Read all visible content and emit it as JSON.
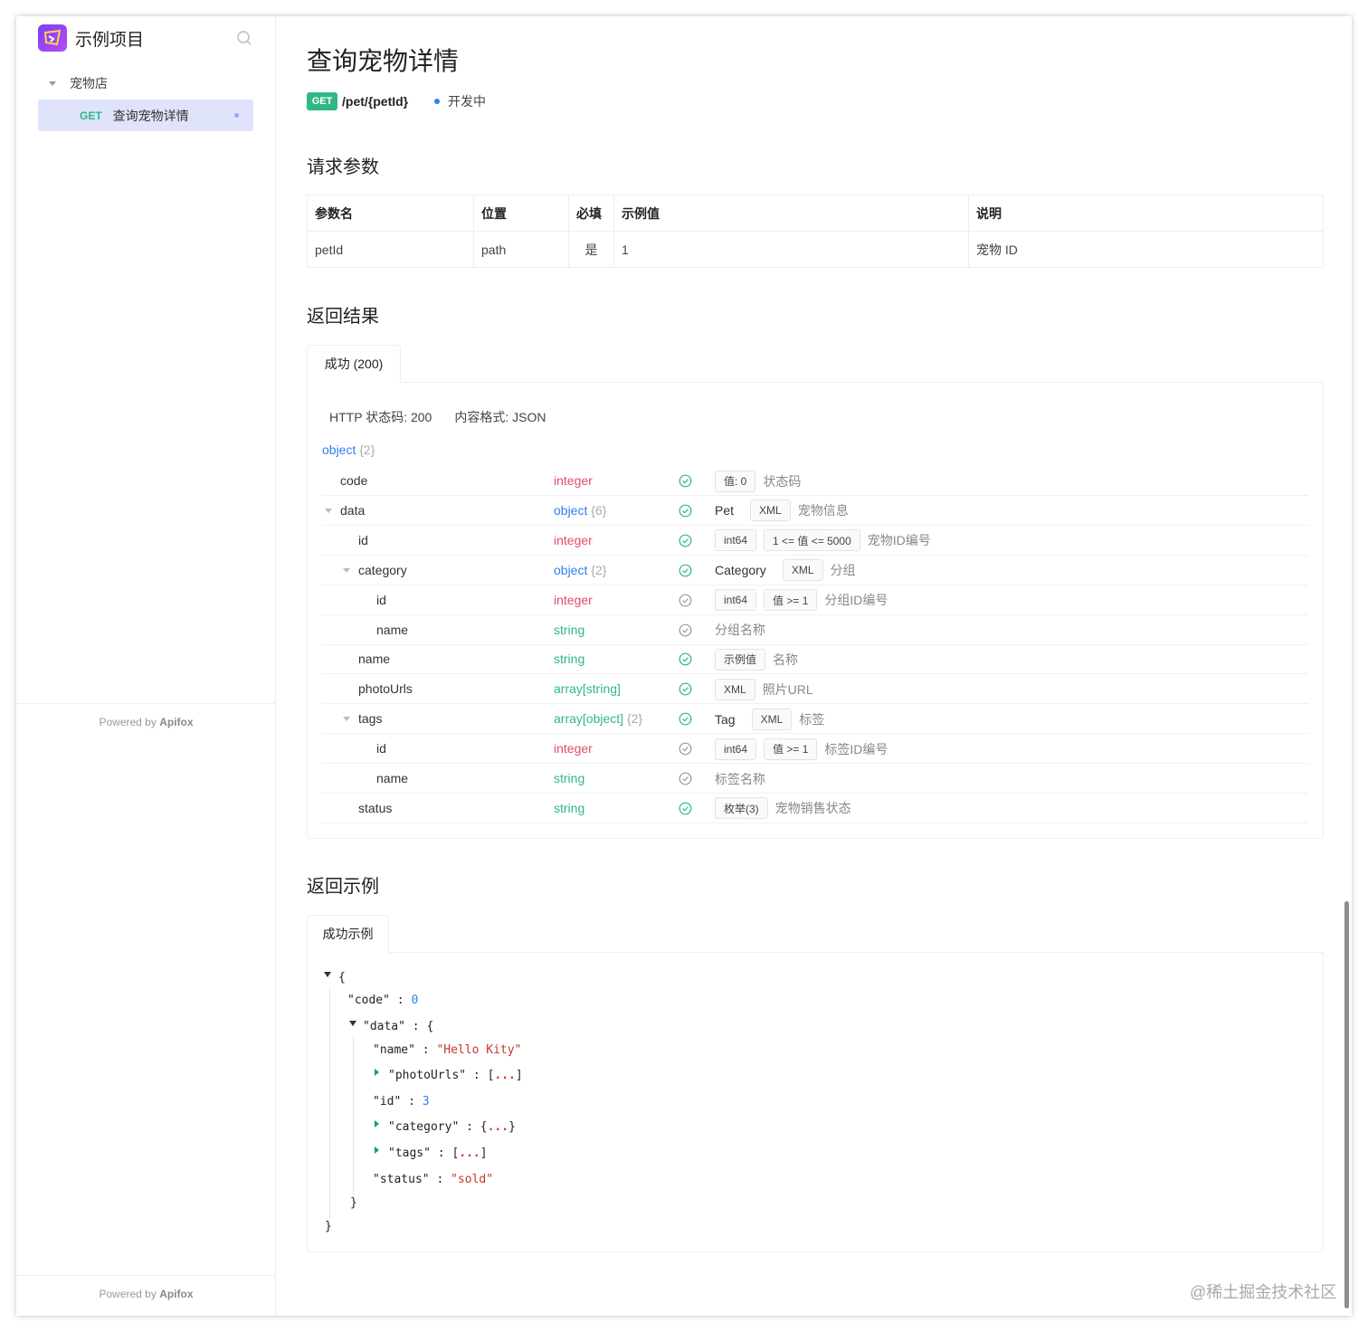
{
  "sidebar": {
    "project_name": "示例项目",
    "folder": "宠物店",
    "api_method": "GET",
    "api_name": "查询宠物详情",
    "powered_prefix": "Powered by",
    "powered_brand": "Apifox"
  },
  "header": {
    "title": "查询宠物详情",
    "method": "GET",
    "path": "/pet/{petId}",
    "status": "开发中"
  },
  "request": {
    "heading": "请求参数",
    "columns": [
      "参数名",
      "位置",
      "必填",
      "示例值",
      "说明"
    ],
    "rows": [
      {
        "name": "petId",
        "in": "path",
        "required": "是",
        "example": "1",
        "desc": "宠物 ID"
      }
    ]
  },
  "response": {
    "heading": "返回结果",
    "tab": "成功 (200)",
    "http_status": "HTTP 状态码: 200",
    "content_type": "内容格式: JSON",
    "root_type": "object",
    "root_count": "{2}",
    "fields": [
      {
        "name": "code",
        "type": "integer",
        "desc": [
          {
            "t": "tag",
            "v": "值: 0"
          },
          {
            "t": "text",
            "v": "状态码"
          }
        ]
      },
      {
        "name": "data",
        "type": "object",
        "count": "{6}",
        "desc": [
          {
            "t": "name",
            "v": "Pet"
          },
          {
            "t": "tag",
            "v": "XML"
          },
          {
            "t": "text",
            "v": "宠物信息"
          }
        ]
      },
      {
        "name": "id",
        "type": "integer",
        "desc": [
          {
            "t": "tag",
            "v": "int64"
          },
          {
            "t": "tag",
            "v": "1 <= 值 <= 5000"
          },
          {
            "t": "text",
            "v": "宠物ID编号"
          }
        ]
      },
      {
        "name": "category",
        "type": "object",
        "count": "{2}",
        "desc": [
          {
            "t": "name",
            "v": "Category"
          },
          {
            "t": "tag",
            "v": "XML"
          },
          {
            "t": "text",
            "v": "分组"
          }
        ]
      },
      {
        "name": "id",
        "type": "integer",
        "desc": [
          {
            "t": "tag",
            "v": "int64"
          },
          {
            "t": "tag",
            "v": "值 >= 1"
          },
          {
            "t": "text",
            "v": "分组ID编号"
          }
        ]
      },
      {
        "name": "name",
        "type": "string",
        "desc": [
          {
            "t": "text",
            "v": "分组名称"
          }
        ]
      },
      {
        "name": "name",
        "type": "string",
        "desc": [
          {
            "t": "tag",
            "v": "示例值"
          },
          {
            "t": "text",
            "v": "名称"
          }
        ]
      },
      {
        "name": "photoUrls",
        "type": "array[string]",
        "desc": [
          {
            "t": "tag",
            "v": "XML"
          },
          {
            "t": "text",
            "v": "照片URL"
          }
        ]
      },
      {
        "name": "tags",
        "type": "array[object]",
        "count": "{2}",
        "desc": [
          {
            "t": "name",
            "v": "Tag"
          },
          {
            "t": "tag",
            "v": "XML"
          },
          {
            "t": "text",
            "v": "标签"
          }
        ]
      },
      {
        "name": "id",
        "type": "integer",
        "desc": [
          {
            "t": "tag",
            "v": "int64"
          },
          {
            "t": "tag",
            "v": "值 >= 1"
          },
          {
            "t": "text",
            "v": "标签ID编号"
          }
        ]
      },
      {
        "name": "name",
        "type": "string",
        "desc": [
          {
            "t": "text",
            "v": "标签名称"
          }
        ]
      },
      {
        "name": "status",
        "type": "string",
        "desc": [
          {
            "t": "tag",
            "v": "枚举(3)"
          },
          {
            "t": "text",
            "v": "宠物销售状态"
          }
        ]
      }
    ]
  },
  "example": {
    "heading": "返回示例",
    "tab": "成功示例",
    "open_brace": "{",
    "close_brace": "}",
    "code_key": "\"code\"",
    "code_val": "0",
    "data_key": "\"data\"",
    "name_key": "\"name\"",
    "name_val": "\"Hello Kity\"",
    "photo_key": "\"photoUrls\"",
    "id_key": "\"id\"",
    "id_val": "3",
    "category_key": "\"category\"",
    "tags_key": "\"tags\"",
    "status_key": "\"status\"",
    "status_val": "\"sold\"",
    "colon": ":",
    "dots": "...",
    "lbracket": "[",
    "rbracket": "]"
  },
  "watermark": "@稀土掘金技术社区",
  "colors": {
    "get": "#2fb885",
    "accent": "#2f7ff2",
    "integer": "#e24a6b",
    "string": "#2fb885"
  }
}
